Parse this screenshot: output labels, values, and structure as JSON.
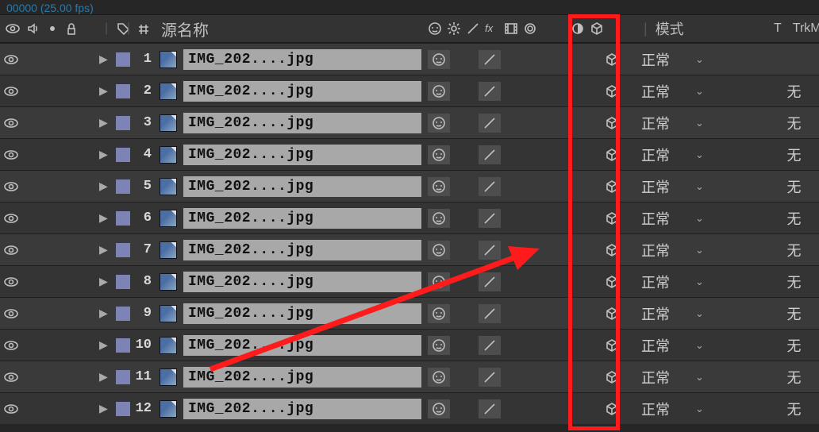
{
  "top_info": "00000 (25.00 fps)",
  "header": {
    "source_name_label": "源名称",
    "mode_label": "模式",
    "t_label": "T",
    "trkm_label": "TrkM"
  },
  "layers": [
    {
      "index": 1,
      "name": "IMG_202....jpg",
      "mode": "正常",
      "track": ""
    },
    {
      "index": 2,
      "name": "IMG_202....jpg",
      "mode": "正常",
      "track": "无"
    },
    {
      "index": 3,
      "name": "IMG_202....jpg",
      "mode": "正常",
      "track": "无"
    },
    {
      "index": 4,
      "name": "IMG_202....jpg",
      "mode": "正常",
      "track": "无"
    },
    {
      "index": 5,
      "name": "IMG_202....jpg",
      "mode": "正常",
      "track": "无"
    },
    {
      "index": 6,
      "name": "IMG_202....jpg",
      "mode": "正常",
      "track": "无"
    },
    {
      "index": 7,
      "name": "IMG_202....jpg",
      "mode": "正常",
      "track": "无"
    },
    {
      "index": 8,
      "name": "IMG_202....jpg",
      "mode": "正常",
      "track": "无"
    },
    {
      "index": 9,
      "name": "IMG_202....jpg",
      "mode": "正常",
      "track": "无"
    },
    {
      "index": 10,
      "name": "IMG_202....jpg",
      "mode": "正常",
      "track": "无"
    },
    {
      "index": 11,
      "name": "IMG_202....jpg",
      "mode": "正常",
      "track": "无"
    },
    {
      "index": 12,
      "name": "IMG_202....jpg",
      "mode": "正常",
      "track": "无"
    }
  ]
}
